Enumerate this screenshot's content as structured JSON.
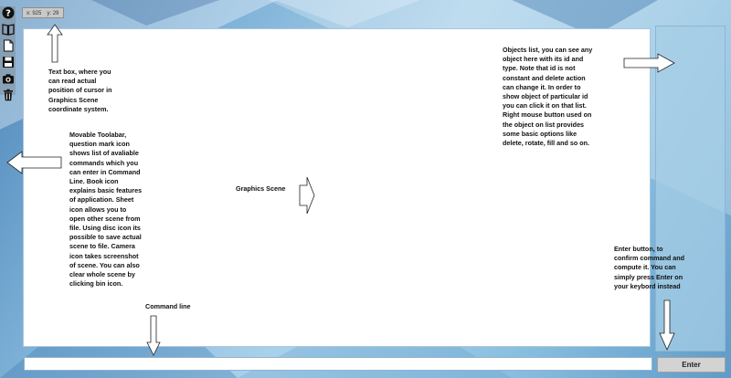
{
  "toolbar": {
    "items": [
      {
        "name": "help",
        "icon": "question-mark-icon"
      },
      {
        "name": "book",
        "icon": "book-icon"
      },
      {
        "name": "sheet",
        "icon": "sheet-icon"
      },
      {
        "name": "save",
        "icon": "disc-icon"
      },
      {
        "name": "screenshot",
        "icon": "camera-icon"
      },
      {
        "name": "clear",
        "icon": "bin-icon"
      }
    ]
  },
  "coords": {
    "x_text": "x: 925",
    "y_text": "y: 29"
  },
  "command_line": {
    "value": "",
    "placeholder": ""
  },
  "enter_button": {
    "label": "Enter"
  },
  "annotations": {
    "text_box": "Text box, where you\ncan read actual\nposition of cursor in\nGraphics Scene\ncoordinate system.",
    "toolbar": "Movable Toolabar,\nquestion mark icon\nshows list of avaliable\ncommands which you\ncan enter in Command\nLine. Book icon\nexplains basic features\nof application. Sheet\nicon allows you to\nopen other scene from\nfile. Using disc icon  its\npossible to save actual\nscene to file. Camera\nicon takes screenshot\nof scene. You can also\nclear whole scene by\nclicking bin icon.",
    "graphics_scene": "Graphics Scene",
    "command_line": "Command line",
    "objects_list": "Objects list, you can see any\nobject here with its id and\ntype. Note that id is not\nconstant and delete action\ncan change it. In order to\nshow object of particular id\nyou can click it on that list.\nRight mouse button used on\nthe object on list provides\nsome basic options like\ndelete, rotate, fill and so on.",
    "enter_button": "Enter button, to\nconfirm command and\ncompute it. You can\nsimply press Enter on\nyour keybord instead"
  },
  "colors": {
    "background_dark": "#4d86b8",
    "background_light": "#aad1ea",
    "scene": "#ffffff",
    "objects_panel": "#a6cee6",
    "enter_button": "#d3d3d3"
  }
}
